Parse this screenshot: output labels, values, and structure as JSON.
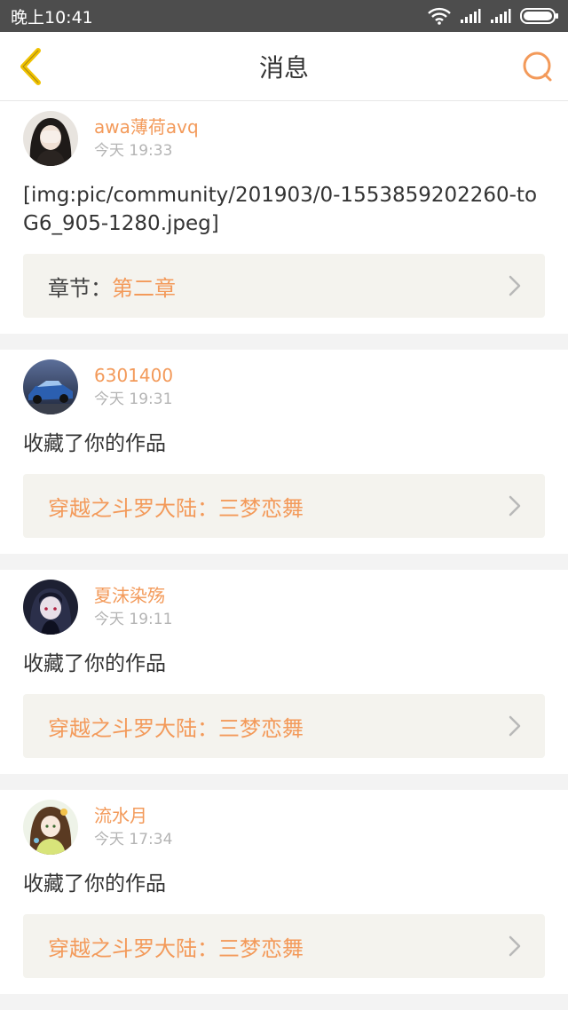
{
  "status": {
    "time": "晚上10:41"
  },
  "nav": {
    "title": "消息"
  },
  "colors": {
    "accent": "#f39a5a",
    "back_icon": "#f0c200",
    "time": "#b4b4b4"
  },
  "messages": [
    {
      "user": "awa薄荷avq",
      "time": "今天 19:33",
      "content": "[img:pic/community/201903/0-1553859202260-toG6_905-1280.jpeg]",
      "link_prefix": "章节：",
      "link_value": "第二章",
      "avatar_icon": "avatar-girl-hiding-face"
    },
    {
      "user": "6301400",
      "time": "今天 19:31",
      "content": "收藏了你的作品",
      "link_prefix": "",
      "link_value": "穿越之斗罗大陆：三梦恋舞",
      "avatar_icon": "avatar-blue-car"
    },
    {
      "user": "夏沫染殇",
      "time": "今天 19:11",
      "content": "收藏了你的作品",
      "link_prefix": "",
      "link_value": "穿越之斗罗大陆：三梦恋舞",
      "avatar_icon": "avatar-dark-anime"
    },
    {
      "user": "流水月",
      "time": "今天 17:34",
      "content": "收藏了你的作品",
      "link_prefix": "",
      "link_value": "穿越之斗罗大陆：三梦恋舞",
      "avatar_icon": "avatar-anime-girl"
    }
  ]
}
